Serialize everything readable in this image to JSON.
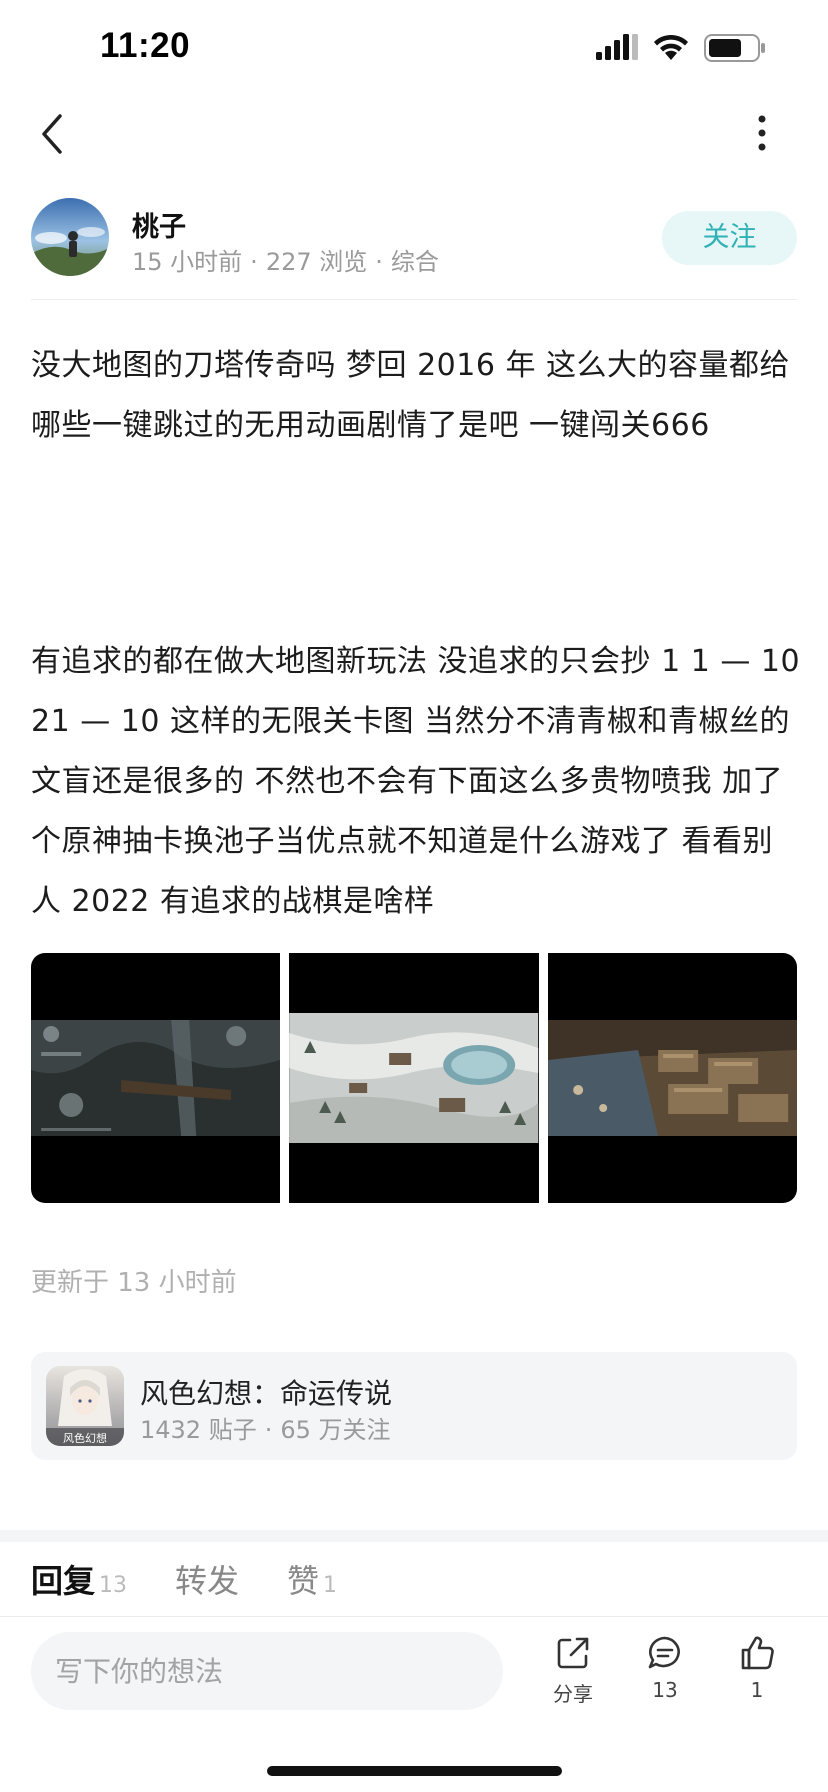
{
  "status_bar": {
    "time": "11:20",
    "icons": [
      "signal-icon",
      "wifi-icon",
      "battery-icon"
    ]
  },
  "nav": {
    "back_icon": "chevron-left-icon",
    "more_icon": "more-vertical-icon"
  },
  "author": {
    "name": "桃子",
    "time_ago": "15 小时前",
    "views": "227 浏览",
    "category": "综合",
    "follow_label": "关注"
  },
  "post": {
    "paragraphs": [
      "没大地图的刀塔传奇吗 梦回 2016 年 这么大的容量都给哪些一键跳过的无用动画剧情了是吧 一键闯关666",
      "有追求的都在做大地图新玩法 没追求的只会抄 1 1 — 10 21 — 10 这样的无限关卡图  当然分不清青椒和青椒丝的文盲还是很多的 不然也不会有下面这么多贵物喷我 加了个原神抽卡换池子当优点就不知道是什么游戏了 看看别人 2022 有追求的战棋是啥样"
    ],
    "images": [
      "game-screenshot-cave",
      "game-screenshot-snow-map",
      "game-screenshot-town"
    ],
    "updated": "更新于 13 小时前"
  },
  "game_card": {
    "name": "风色幻想：命运传说",
    "posts": "1432 贴子",
    "followers": "65 万关注",
    "icon_text": "风色幻想"
  },
  "tabs": [
    {
      "label": "回复",
      "count": "13"
    },
    {
      "label": "转发",
      "count": ""
    },
    {
      "label": "赞",
      "count": "1"
    }
  ],
  "bottom_bar": {
    "input_placeholder": "写下你的想法",
    "share_label": "分享",
    "comment_count": "13",
    "like_count": "1"
  },
  "colors": {
    "accent": "#2fb1b5",
    "follow_bg": "#e7f6f6",
    "card_bg": "#f4f5f7",
    "meta": "#9a9a9a"
  }
}
